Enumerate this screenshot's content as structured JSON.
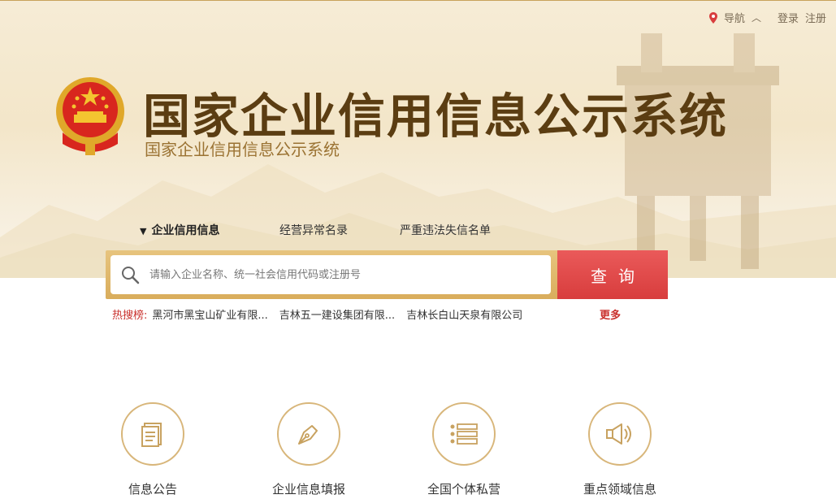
{
  "topbar": {
    "nav_label": "导航",
    "nav_caret": "^",
    "login": "登录",
    "register": "注册"
  },
  "header": {
    "title": "国家企业信用信息公示系统",
    "subtitle": "国家企业信用信息公示系统"
  },
  "tabs": [
    {
      "label": "企业信用信息",
      "active": true
    },
    {
      "label": "经营异常名录",
      "active": false
    },
    {
      "label": "严重违法失信名单",
      "active": false
    }
  ],
  "search": {
    "placeholder": "请输入企业名称、统一社会信用代码或注册号",
    "value": "",
    "button": "查询"
  },
  "hot_search": {
    "label": "热搜榜:",
    "items": [
      "黑河市黑宝山矿业有限...",
      "吉林五一建设集团有限...",
      "吉林长白山天泉有限公司"
    ],
    "more": "更多"
  },
  "features": [
    {
      "label": "信息公告",
      "icon": "document-icon"
    },
    {
      "label": "企业信息填报",
      "icon": "pen-nib-icon"
    },
    {
      "label": "全国个体私营",
      "icon": "list-icon"
    },
    {
      "label": "重点领域信息",
      "icon": "speaker-icon"
    }
  ],
  "colors": {
    "accent_gold": "#d8b67a",
    "title_brown": "#5b3d12",
    "search_red": "#d83d3d",
    "hot_red": "#c9302c"
  }
}
